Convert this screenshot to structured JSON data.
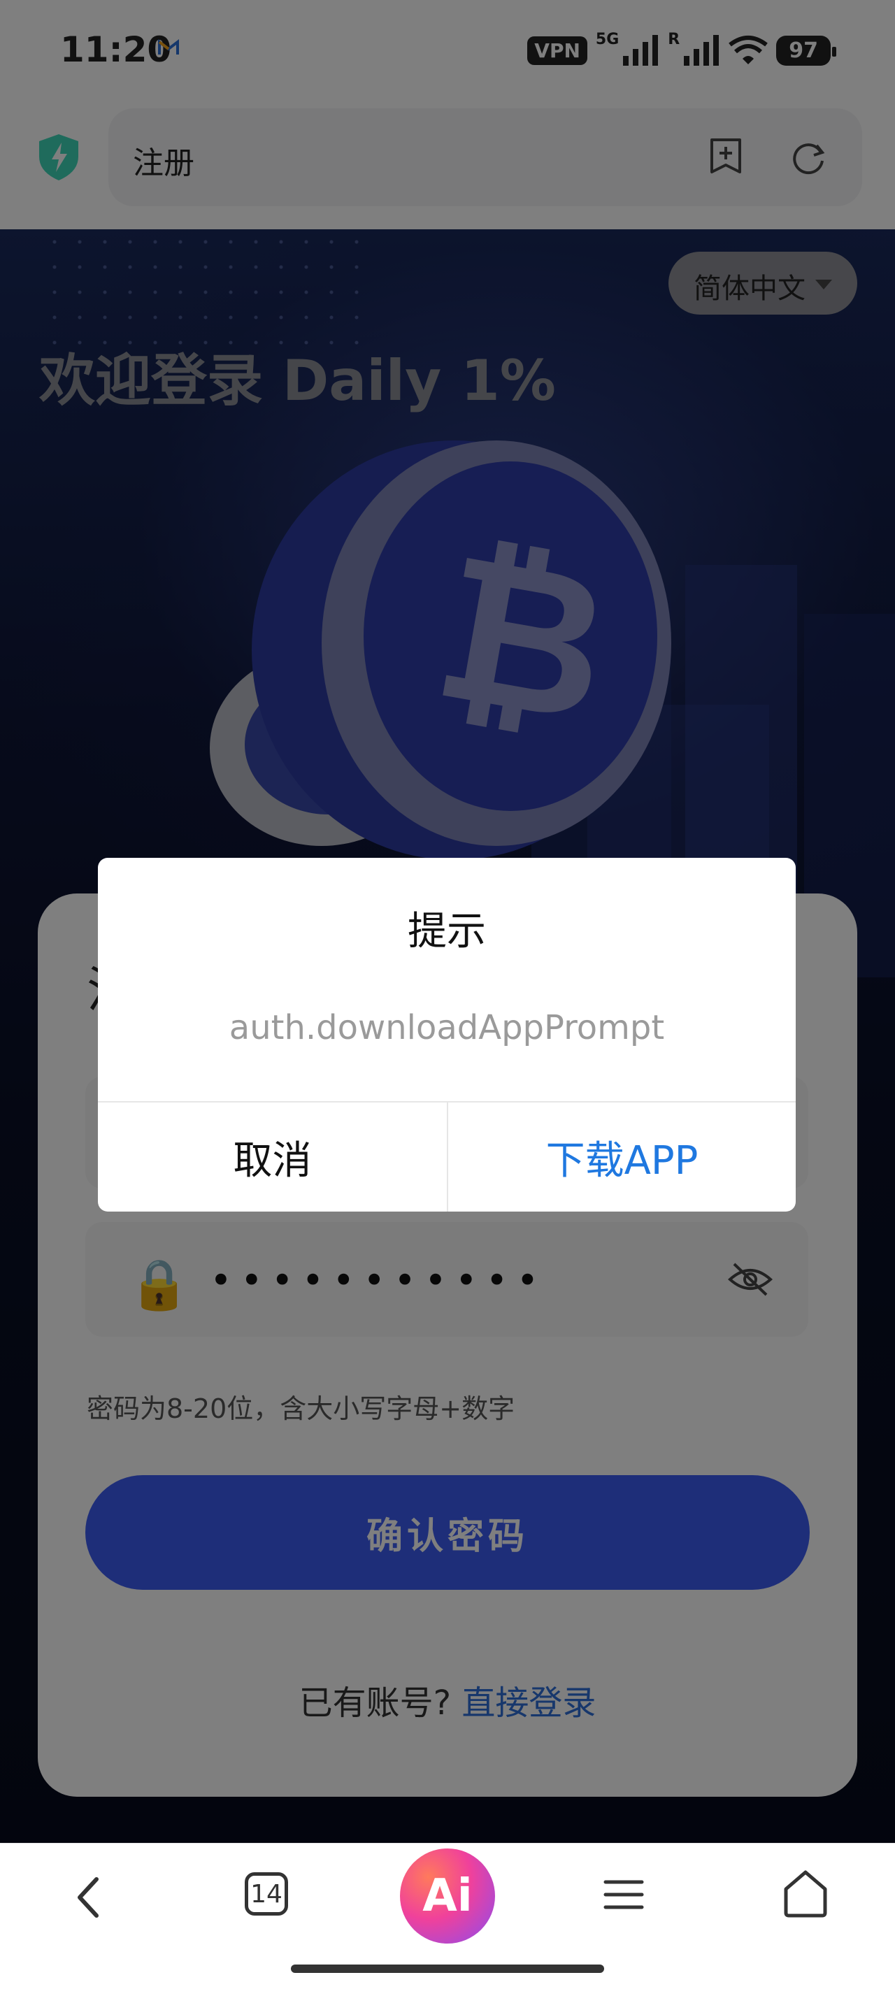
{
  "status_bar": {
    "time": "11:20",
    "vpn_label": "VPN",
    "net_label_1": "5G",
    "net_label_2": "R",
    "battery": "97"
  },
  "browser": {
    "page_title": "注册"
  },
  "hero": {
    "language": "简体中文",
    "welcome": "欢迎登录 Daily 1%"
  },
  "form": {
    "heading_glyph": "注",
    "password_mask": "•••••••••••",
    "hint": "密码为8-20位，含大小写字母+数字",
    "confirm_button": "确认密码",
    "login_prompt": "已有账号?",
    "login_link": "直接登录"
  },
  "dialog": {
    "title": "提示",
    "message": "auth.downloadAppPrompt",
    "cancel": "取消",
    "download": "下载APP"
  },
  "bottom_nav": {
    "tab_count": "14",
    "ai_label": "Ai"
  },
  "colors": {
    "primary_button": "#3c5cf2",
    "link_blue": "#2f6fd8",
    "dialog_action_blue": "#1f78e0",
    "shield_green": "#3fd6b8"
  }
}
